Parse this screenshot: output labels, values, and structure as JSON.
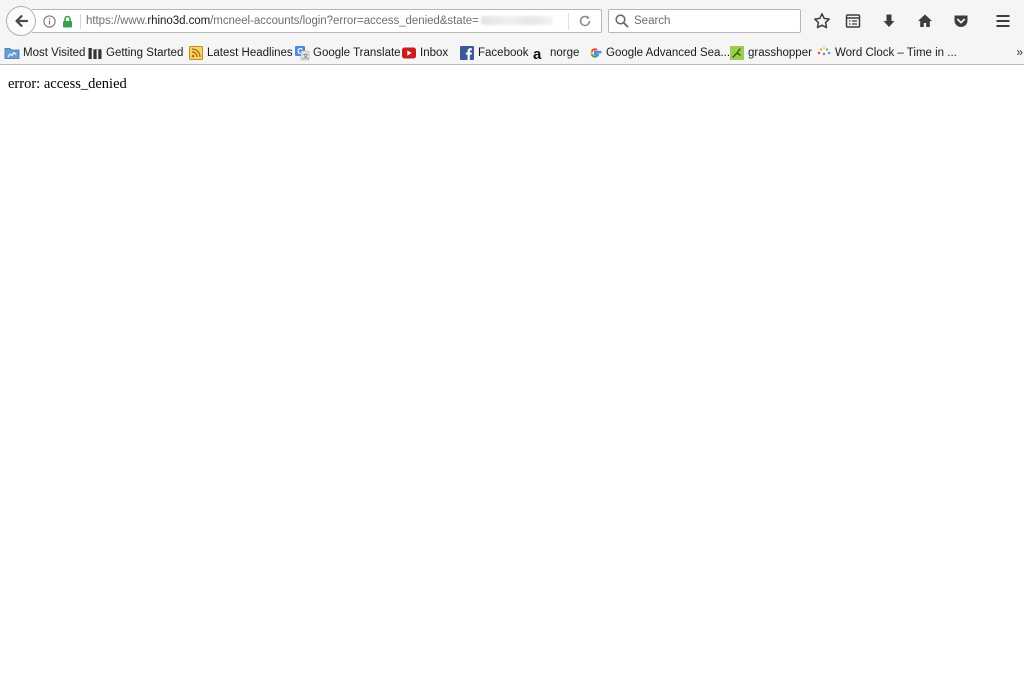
{
  "navbar": {
    "url": {
      "prefix": "https://www.",
      "host": "rhino3d.com",
      "path": "/mcneel-accounts/login?error=access_denied&state="
    },
    "search_placeholder": "Search"
  },
  "bookmarks": {
    "items": [
      {
        "label": "Most Visited",
        "icon": "folder-icon"
      },
      {
        "label": "Getting Started",
        "icon": "m-logo-icon"
      },
      {
        "label": "Latest Headlines",
        "icon": "rss-icon"
      },
      {
        "label": "Google Translate",
        "icon": "google-translate-icon"
      },
      {
        "label": "Inbox",
        "icon": "youtube-icon"
      },
      {
        "label": "Facebook",
        "icon": "facebook-icon"
      },
      {
        "label": "norge",
        "icon": "a-logo-icon"
      },
      {
        "label": "Google Advanced Sea...",
        "icon": "google-icon"
      },
      {
        "label": "grasshopper",
        "icon": "grasshopper-icon"
      },
      {
        "label": "Word Clock – Time in ...",
        "icon": "word-clock-icon"
      }
    ],
    "overflow": "»"
  },
  "page": {
    "error_text": "error: access_denied"
  },
  "colors": {
    "toolbar_bg": "#f5f5f5",
    "lock_green": "#3aa14b",
    "youtube_red": "#cc1b1b",
    "facebook_blue": "#3b5998",
    "rss_orange": "#e8a21f"
  }
}
